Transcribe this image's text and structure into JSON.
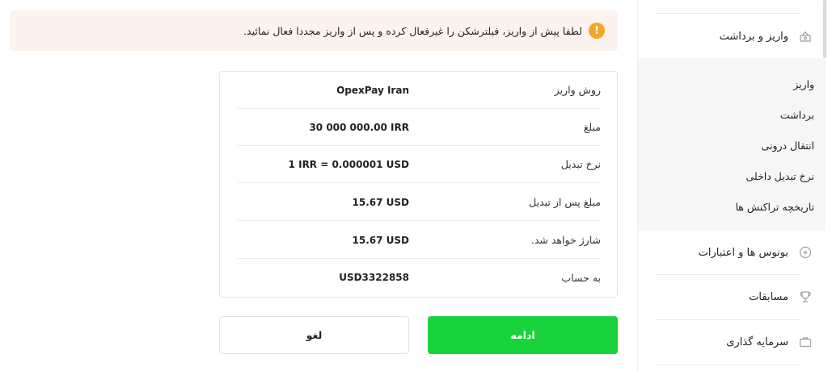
{
  "alert": {
    "icon": "warning-icon",
    "color": "#f5a623",
    "text": "لطفا پیش از واریز، فیلترشکن را غیرفعال کرده و پس از واریز مجددا فعال نمائید."
  },
  "details": [
    {
      "label": "روش واریز",
      "value": "OpexPay Iran"
    },
    {
      "label": "مبلغ",
      "value": "30 000 000.00 IRR"
    },
    {
      "label": "نرخ تبدیل",
      "value": "1 IRR = 0.000001 USD"
    },
    {
      "label": "مبلغ پس از تبدیل",
      "value": "15.67 USD"
    },
    {
      "label": "شارژ خواهد شد.",
      "value": "15.67 USD"
    },
    {
      "label": "به حساب",
      "value": "USD3322858"
    }
  ],
  "buttons": {
    "cancel_label": "لغو",
    "continue_label": "ادامه",
    "continue_color": "#19d33c"
  },
  "sidebar": {
    "active_section": {
      "label": "واریز و برداشت",
      "icon": "wallet-icon"
    },
    "sub_items": [
      {
        "label": "واریز"
      },
      {
        "label": "برداشت"
      },
      {
        "label": "انتقال درونی"
      },
      {
        "label": "نرخ تبدیل داخلی"
      },
      {
        "label": "تاریخچه تراکنش ها"
      }
    ],
    "sections": [
      {
        "label": "بونوس ها و اعتبارات",
        "icon": "bonus-icon"
      },
      {
        "label": "مسابقات",
        "icon": "trophy-icon"
      },
      {
        "label": "سرمایه گذاری",
        "icon": "briefcase-icon"
      }
    ]
  }
}
